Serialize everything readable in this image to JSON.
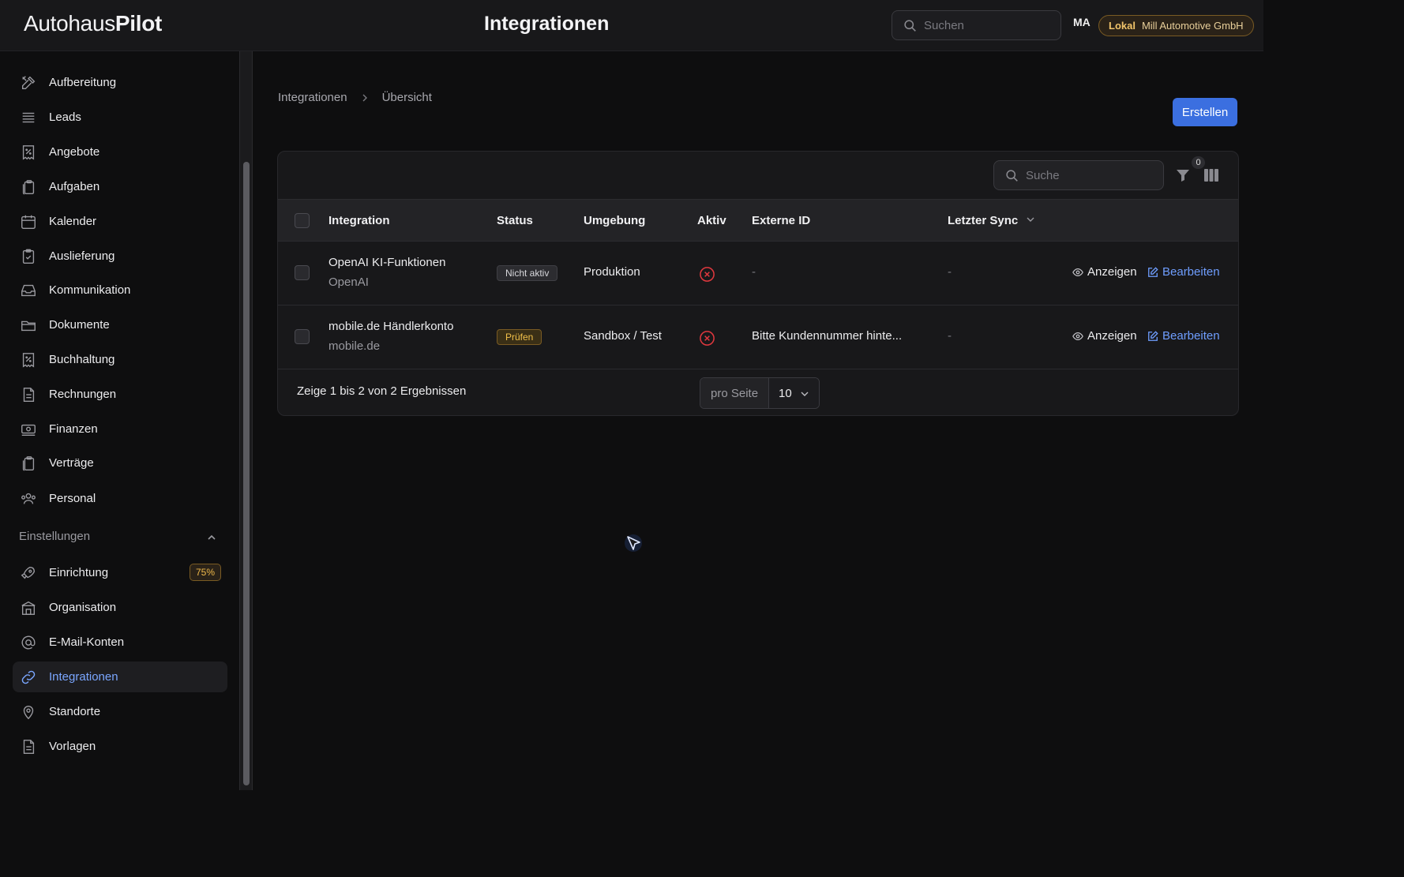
{
  "header": {
    "logo_light": "Autohaus",
    "logo_bold": "Pilot",
    "title": "Integrationen",
    "search_placeholder": "Suchen",
    "avatar": "MA",
    "environment": "Lokal",
    "organization": "Mill Automotive GmbH"
  },
  "sidebar": {
    "items": [
      {
        "label": "Aufbereitung",
        "icon": "tools-icon"
      },
      {
        "label": "Leads",
        "icon": "list-icon"
      },
      {
        "label": "Angebote",
        "icon": "receipt-percent-icon"
      },
      {
        "label": "Aufgaben",
        "icon": "clipboard-stack-icon"
      },
      {
        "label": "Kalender",
        "icon": "calendar-icon"
      },
      {
        "label": "Auslieferung",
        "icon": "clipboard-check-icon"
      },
      {
        "label": "Kommunikation",
        "icon": "inbox-icon"
      },
      {
        "label": "Dokumente",
        "icon": "folder-icon"
      },
      {
        "label": "Buchhaltung",
        "icon": "receipt-percent-icon"
      },
      {
        "label": "Rechnungen",
        "icon": "document-icon"
      },
      {
        "label": "Finanzen",
        "icon": "banknotes-icon"
      },
      {
        "label": "Verträge",
        "icon": "clipboard-stack-icon"
      },
      {
        "label": "Personal",
        "icon": "users-icon"
      }
    ],
    "settings_section": "Einstellungen",
    "settings_items": [
      {
        "label": "Einrichtung",
        "icon": "rocket-icon",
        "badge": "75%"
      },
      {
        "label": "Organisation",
        "icon": "building-icon"
      },
      {
        "label": "E-Mail-Konten",
        "icon": "at-sign-icon"
      },
      {
        "label": "Integrationen",
        "icon": "link-icon",
        "active": true
      },
      {
        "label": "Standorte",
        "icon": "map-pin-icon"
      },
      {
        "label": "Vorlagen",
        "icon": "document-icon"
      }
    ]
  },
  "breadcrumb": [
    "Integrationen",
    "Übersicht"
  ],
  "create_label": "Erstellen",
  "table": {
    "search_placeholder": "Suche",
    "filter_count": "0",
    "columns": {
      "integration": "Integration",
      "status": "Status",
      "environment": "Umgebung",
      "active": "Aktiv",
      "external_id": "Externe ID",
      "last_sync": "Letzter Sync"
    },
    "rows": [
      {
        "name": "OpenAI KI-Funktionen",
        "provider": "OpenAI",
        "status": "Nicht aktiv",
        "environment": "Produktion",
        "external_id": "-",
        "last_sync": "-",
        "view": "Anzeigen",
        "edit": "Bearbeiten"
      },
      {
        "name": "mobile.de Händlerkonto",
        "provider": "mobile.de",
        "status": "Prüfen",
        "environment": "Sandbox / Test",
        "external_id": "Bitte Kundennummer hinte...",
        "last_sync": "-",
        "view": "Anzeigen",
        "edit": "Bearbeiten"
      }
    ],
    "footer": "Zeige 1 bis 2 von 2 Ergebnissen",
    "per_page_label": "pro Seite",
    "per_page_value": "10"
  },
  "colors": {
    "accent": "#3b6fe0",
    "active_link": "#7aa6ff",
    "warning": "#f1c04a",
    "danger": "#e0383e"
  }
}
